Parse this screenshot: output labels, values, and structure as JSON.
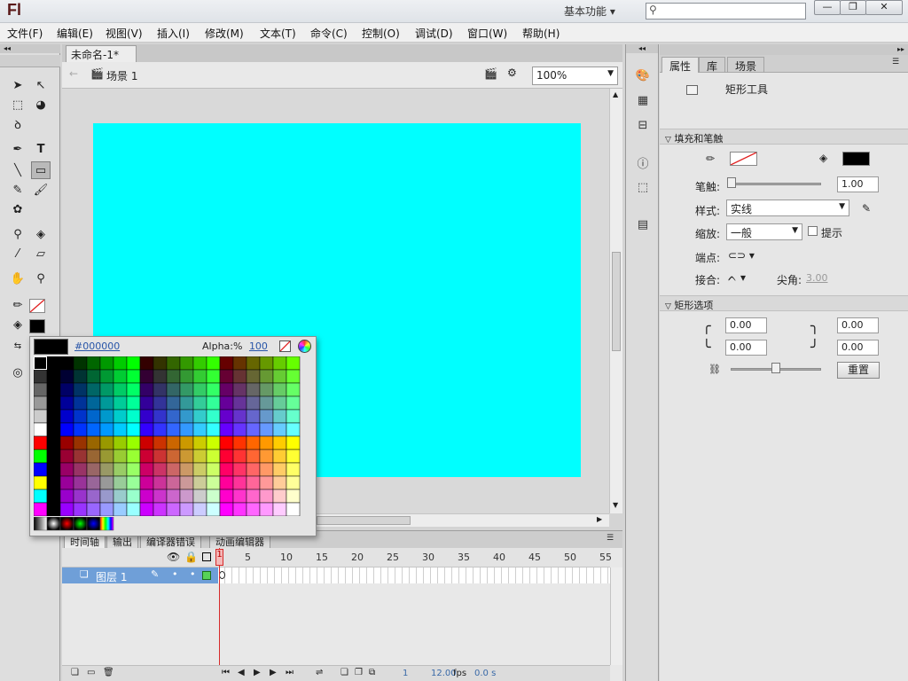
{
  "app": {
    "logo": "Fl",
    "workspace": "基本功能 ▾",
    "search_placeholder": ""
  },
  "window_controls": {
    "minimize": "—",
    "restore": "❐",
    "close": "✕"
  },
  "menu": [
    "文件(F)",
    "编辑(E)",
    "视图(V)",
    "插入(I)",
    "修改(M)",
    "文本(T)",
    "命令(C)",
    "控制(O)",
    "调试(D)",
    "窗口(W)",
    "帮助(H)"
  ],
  "document": {
    "tab_label": "未命名-1*",
    "tab_close": "×",
    "scene_label": "场景 1",
    "zoom": "100%"
  },
  "stage": {
    "color": "#00ffff"
  },
  "swatch_popup": {
    "hex": "#000000",
    "alpha_label": "Alpha:%",
    "alpha_value": "100"
  },
  "timeline": {
    "tabs": [
      "时间轴",
      "输出",
      "编译器错误",
      "动画编辑器"
    ],
    "frame_numbers": [
      "1",
      "5",
      "10",
      "15",
      "20",
      "25",
      "30",
      "35",
      "40",
      "45",
      "50",
      "55"
    ],
    "layer_name": "图层 1",
    "current_frame": "1",
    "fps": "12.00",
    "fps_unit": "fps",
    "time": "0.0 s"
  },
  "properties": {
    "tabs": [
      "属性",
      "库",
      "场景"
    ],
    "tool_name": "矩形工具",
    "fill_stroke_title": "填充和笔触",
    "stroke_label": "笔触:",
    "stroke_value": "1.00",
    "style_label": "样式:",
    "style_value": "实线",
    "scale_label": "缩放:",
    "scale_value": "一般",
    "hint_label": "提示",
    "cap_label": "端点:",
    "join_label": "接合:",
    "miter_label": "尖角:",
    "miter_value": "3.00",
    "rect_options_title": "矩形选项",
    "corner_tl": "0.00",
    "corner_tr": "0.00",
    "corner_bl": "0.00",
    "corner_br": "0.00",
    "reset_label": "重置"
  }
}
